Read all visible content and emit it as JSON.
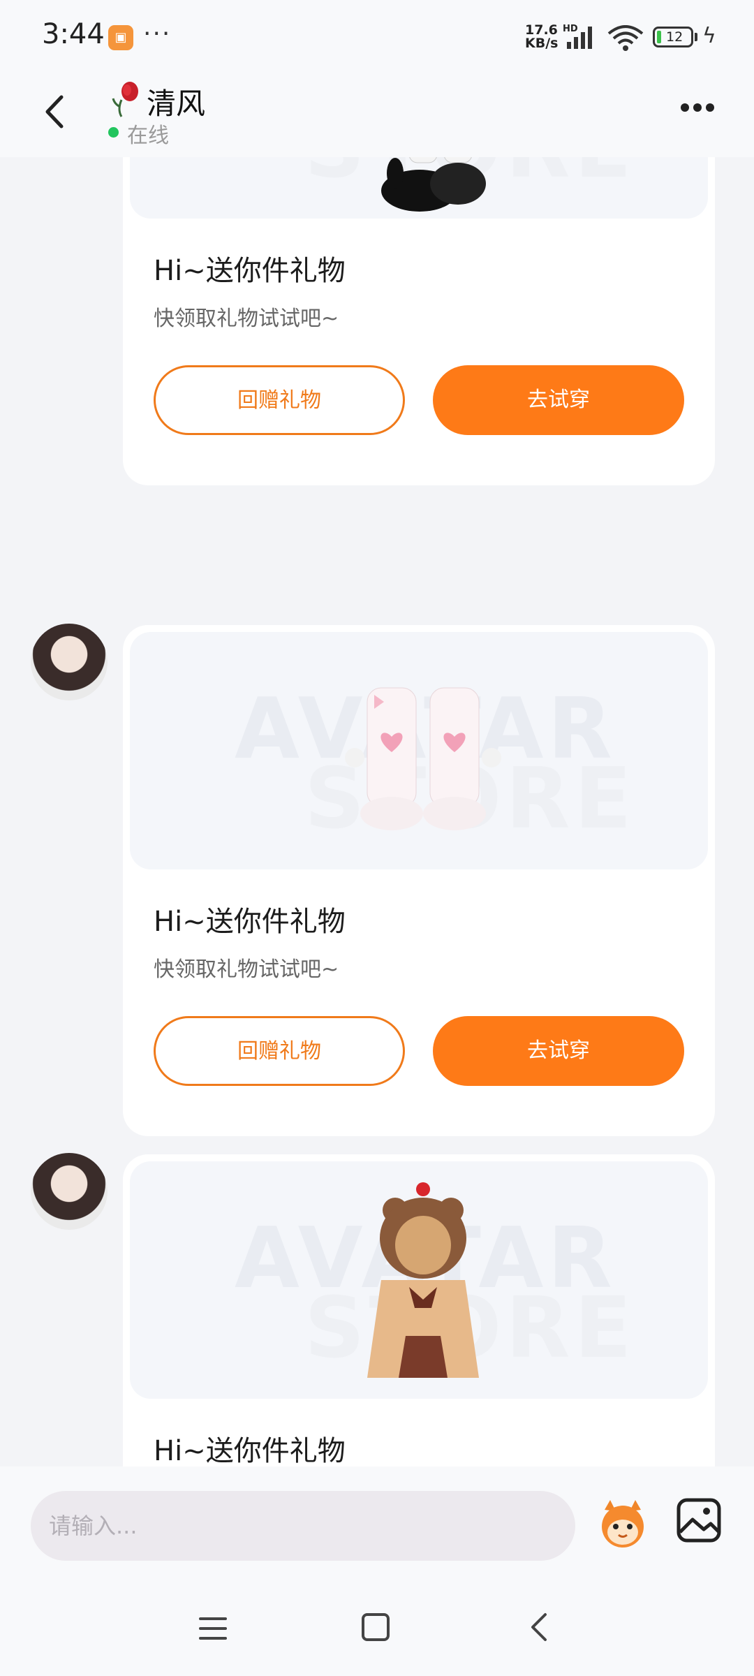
{
  "status_bar": {
    "time": "3:44",
    "speed_value": "17.6",
    "speed_unit": "KB/s",
    "hd": "HD",
    "battery": "12"
  },
  "header": {
    "contact_name": "清风",
    "status_text": "在线"
  },
  "messages": [
    {
      "title": "Hi~送你件礼物",
      "subtitle": "快领取礼物试试吧~",
      "return_gift_label": "回赠礼物",
      "try_on_label": "去试穿",
      "item": "bunny-slipper-boots-icon"
    },
    {
      "title": "Hi~送你件礼物",
      "subtitle": "快领取礼物试试吧~",
      "return_gift_label": "回赠礼物",
      "try_on_label": "去试穿",
      "item": "pink-heart-boots-icon"
    },
    {
      "title": "Hi~送你件礼物",
      "item": "bear-hoodie-outfit-icon"
    }
  ],
  "input": {
    "placeholder": "请输入..."
  },
  "colors": {
    "accent": "#fe7a17",
    "online": "#22c55e"
  }
}
